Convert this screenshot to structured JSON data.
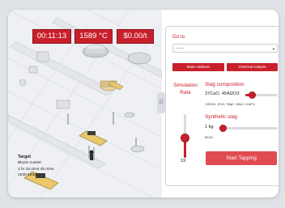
{
  "hud": {
    "time": "00:11:13",
    "temperature": "1589 °C",
    "cost_rate": "$0.00/t"
  },
  "target": {
    "heading": "Target",
    "lines": [
      "Bloom Caster",
      "1 hr 15 mins 45 mins",
      "1530-1540°C"
    ]
  },
  "panel": {
    "goto_label": "Go to",
    "goto_value": "------",
    "make_additions_label": "Make Additions",
    "chemical_analysis_label": "Chemical Analysis",
    "simulation_rate_label": "Simulation Rate",
    "simulation_rate_value": "19",
    "simulation_rate_fraction": 0.45,
    "slag_composition_label": "Slag composition",
    "slag_composition_value": "37CaO, 45Al2O3",
    "slag_composition_detail": "(+8SiO2, 1FeO, 7MgO, 1MnO, 1CaF2)",
    "slag_composition_fraction": 0.2,
    "synthetic_slag_label": "Synthetic slag",
    "synthetic_slag_value": "1 kg",
    "synthetic_slag_cost": "$2101",
    "synthetic_slag_fraction": 0.04,
    "start_tapping_label": "Start Tapping"
  },
  "colors": {
    "accent": "#c8202b",
    "button": "#e04b52"
  }
}
